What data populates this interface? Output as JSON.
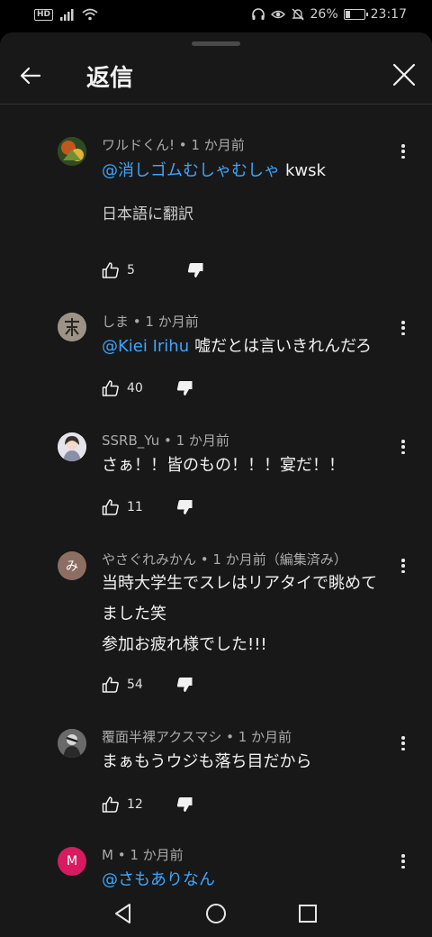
{
  "status_bar": {
    "hd_label": "HD",
    "battery_text": "26%",
    "battery_level": 0.26,
    "time": "23:17"
  },
  "header": {
    "title": "返信"
  },
  "comments": [
    {
      "author_meta": "ワルドくん! • 1 か月前",
      "mention": "@消しゴムむしゃむしゃ",
      "text": "kwsk",
      "translate_label": "日本語に翻訳",
      "likes": "5",
      "avatar_color": "#3a5a2a"
    },
    {
      "author_meta": "しま • 1 か月前",
      "mention": "@Kiei Irihu",
      "text": "嘘だとは言いきれんだろ",
      "likes": "40",
      "avatar_color": "#8a7f72"
    },
    {
      "author_meta": "SSRB_Yu • 1 か月前",
      "text": "さぁ！！皆のもの！！！宴だ！！",
      "likes": "11",
      "avatar_color": "#c9c9d2"
    },
    {
      "author_meta": "やさぐれみかん • 1 か月前（編集済み）",
      "avatar_letter": "み",
      "lines": [
        "当時大学生でスレはリアタイで眺めて",
        "ました笑",
        "参加お疲れ様でした!!!"
      ],
      "likes": "54",
      "avatar_color": "#8d6e63"
    },
    {
      "author_meta": "覆面半裸アクスマシ • 1 か月前",
      "text": "まぁもうウジも落ち目だから",
      "likes": "12",
      "avatar_color": "#5a5a5a"
    },
    {
      "author_meta": "M • 1 か月前",
      "avatar_letter": "M",
      "mention": "@さもありなん",
      "avatar_color": "#d81b60"
    }
  ]
}
